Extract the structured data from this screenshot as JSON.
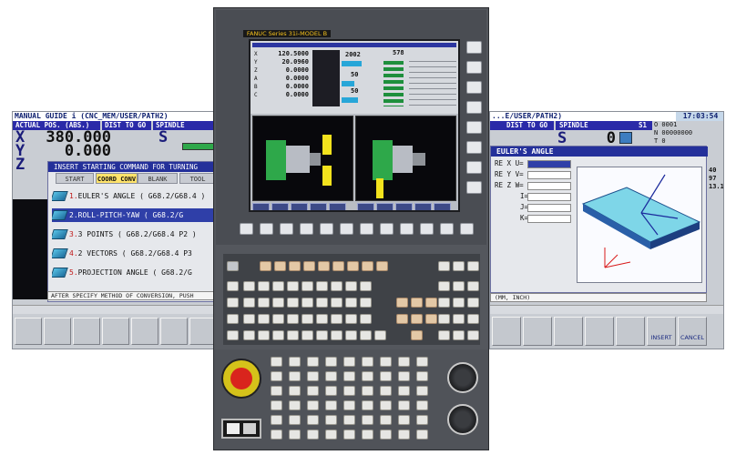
{
  "left_screen": {
    "title": "MANUAL GUIDE i  (CNC_MEM/USER/PATH2)",
    "actual_pos_label": "ACTUAL POS. (ABS.)",
    "dist_label": "DIST TO GO",
    "spindle_label": "SPINDLE",
    "axes": [
      {
        "name": "X",
        "value": "380.000"
      },
      {
        "name": "Y",
        "value": "0.000"
      },
      {
        "name": "Z",
        "value": ""
      }
    ],
    "spindle_axis": "S",
    "dialog_title": "INSERT STARTING COMMAND FOR TURNING",
    "tabs": [
      "START",
      "COORD CONV",
      "BLANK",
      "TOOL"
    ],
    "active_tab": "COORD CONV",
    "options": [
      {
        "num": "1.",
        "label": "EULER'S ANGLE  ( G68.2/G68.4 )",
        "selected": false
      },
      {
        "num": "2.",
        "label": "ROLL-PITCH-YAW  ( G68.2/G",
        "selected": true
      },
      {
        "num": "3.",
        "label": "3 POINTS  ( G68.2/G68.4 P2 )",
        "selected": false
      },
      {
        "num": "4.",
        "label": "2 VECTORS  ( G68.2/G68.4 P3",
        "selected": false
      },
      {
        "num": "5.",
        "label": "PROJECTION ANGLE  ( G68.2/G",
        "selected": false
      }
    ],
    "message": "AFTER SPECIFY METHOD OF CONVERSION, PUSH"
  },
  "center_panel": {
    "brand": "FANUC Series 31i-MODEL B",
    "lcd": {
      "values": [
        "120.5000",
        "20.0960",
        "0.0000",
        "0.0000",
        "0.0000",
        "0.0000"
      ],
      "axis_letters": [
        "X",
        "Y",
        "Z",
        "A",
        "B",
        "C"
      ],
      "spindle_values": [
        "2002",
        "50",
        "50"
      ],
      "feed_value": "578",
      "graph_left_title": "",
      "graph_right_title": ""
    }
  },
  "right_screen": {
    "title": "...E/USER/PATH2)",
    "clock": "17:03:54",
    "dist_label": "DIST TO GO",
    "spindle_label": "SPINDLE",
    "spindle_code": "S1",
    "o_label": "O 0001",
    "n_label": "N 00000000",
    "t_label": "T 0",
    "spindle_axis": "S",
    "spindle_value": "0",
    "dialog_title": "EULER'S ANGLE",
    "fields": [
      {
        "label": "RE X",
        "key": "U="
      },
      {
        "label": "RE Y",
        "key": "V="
      },
      {
        "label": "RE Z",
        "key": "W="
      },
      {
        "label": "",
        "key": "I="
      },
      {
        "label": "",
        "key": "J="
      },
      {
        "label": "",
        "key": "K="
      }
    ],
    "side_values": [
      "40",
      "97",
      "13.1"
    ],
    "unit_text": "(MM, INCH)",
    "softkeys": [
      {
        "label": "INSERT"
      },
      {
        "label": "CANCEL"
      }
    ]
  }
}
